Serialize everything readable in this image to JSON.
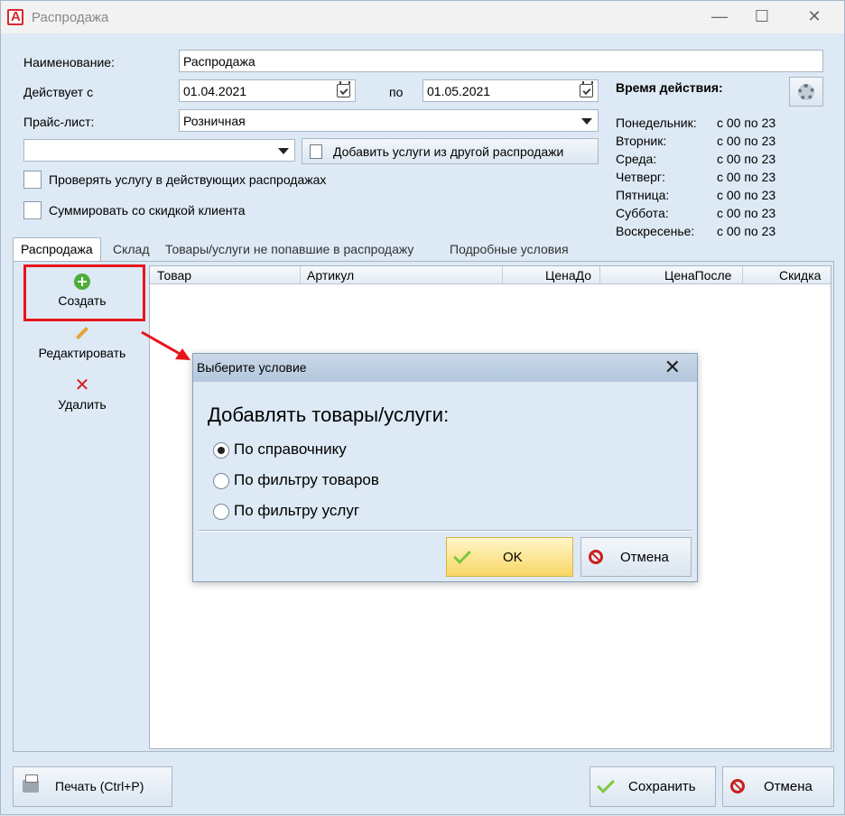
{
  "window": {
    "title": "Распродажа",
    "minimize": "—",
    "maximize": "☐",
    "close": "✕"
  },
  "form": {
    "name_label": "Наименование:",
    "name_value": "Распродажа",
    "valid_from_label": "Действует с",
    "valid_from": "01.04.2021",
    "to_label": "по",
    "valid_to": "01.05.2021",
    "pricelist_label": "Прайс-лист:",
    "pricelist_value": "Розничная",
    "sale_select_value": "",
    "add_services_button": "Добавить услуги из другой распродажи",
    "check_service_label": "Проверять услугу в действующих распродажах",
    "sum_discount_label": "Суммировать со скидкой клиента"
  },
  "schedule": {
    "title": "Время действия:",
    "days": [
      {
        "day": "Понедельник:",
        "time": "с 00 по 23"
      },
      {
        "day": "Вторник:",
        "time": "с 00 по 23"
      },
      {
        "day": "Среда:",
        "time": "с 00 по 23"
      },
      {
        "day": "Четверг:",
        "time": "с 00 по 23"
      },
      {
        "day": "Пятница:",
        "time": "с 00 по 23"
      },
      {
        "day": "Суббота:",
        "time": "с 00 по 23"
      },
      {
        "day": "Воскресенье:",
        "time": "с 00 по 23"
      }
    ]
  },
  "tabs": [
    "Распродажа",
    "Склад",
    "Товары/услуги не попавшие в распродажу",
    "Подробные условия"
  ],
  "side": {
    "create": "Создать",
    "edit": "Редактировать",
    "delete": "Удалить"
  },
  "grid": {
    "columns": [
      "Товар",
      "Артикул",
      "ЦенаДо",
      "ЦенаПосле",
      "Скидка"
    ]
  },
  "dialog": {
    "title": "Выберите условие",
    "heading": "Добавлять товары/услуги:",
    "options": [
      "По справочнику",
      "По фильтру товаров",
      "По фильтру услуг"
    ],
    "selected_index": 0,
    "ok": "OK",
    "cancel": "Отмена"
  },
  "bottom": {
    "print": "Печать (Ctrl+P)",
    "save": "Сохранить",
    "cancel": "Отмена"
  },
  "colors": {
    "highlight": "#e8141a",
    "ok_button": "#f9d766",
    "accent_green": "#4cae3a"
  }
}
